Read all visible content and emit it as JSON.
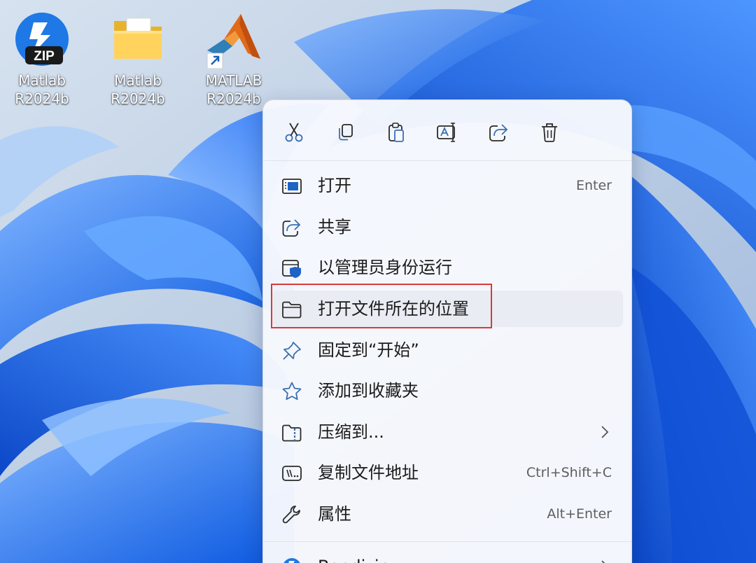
{
  "desktop": {
    "icons": [
      {
        "icon": "zip-archive-icon",
        "line1": "Matlab",
        "line2": "R2024b"
      },
      {
        "icon": "folder-icon",
        "line1": "Matlab",
        "line2": "R2024b"
      },
      {
        "icon": "matlab-shortcut-icon",
        "line1": "MATLAB",
        "line2": "R2024b"
      }
    ]
  },
  "context_menu": {
    "toolbar": [
      {
        "name": "cut",
        "icon": "scissors-icon"
      },
      {
        "name": "copy",
        "icon": "copy-icon"
      },
      {
        "name": "paste",
        "icon": "clipboard-icon"
      },
      {
        "name": "rename",
        "icon": "rename-icon"
      },
      {
        "name": "share",
        "icon": "share-icon"
      },
      {
        "name": "delete",
        "icon": "trash-icon"
      }
    ],
    "items": [
      {
        "label": "打开",
        "shortcut": "Enter",
        "icon": "open-app-icon"
      },
      {
        "label": "共享",
        "shortcut": "",
        "icon": "share-icon"
      },
      {
        "label": "以管理员身份运行",
        "shortcut": "",
        "icon": "admin-shield-icon"
      },
      {
        "label": "打开文件所在的位置",
        "shortcut": "",
        "icon": "folder-open-icon",
        "highlighted": true
      },
      {
        "label": "固定到“开始”",
        "shortcut": "",
        "icon": "pin-icon"
      },
      {
        "label": "添加到收藏夹",
        "shortcut": "",
        "icon": "star-icon"
      },
      {
        "label": "压缩到...",
        "shortcut": "",
        "icon": "zip-folder-icon",
        "submenu": true
      },
      {
        "label": "复制文件地址",
        "shortcut": "Ctrl+Shift+C",
        "icon": "copy-path-icon"
      },
      {
        "label": "属性",
        "shortcut": "Alt+Enter",
        "icon": "wrench-icon"
      },
      {
        "label": "Bandizip",
        "shortcut": "",
        "icon": "bandizip-icon",
        "submenu": true
      }
    ]
  },
  "colors": {
    "highlight_border": "#d93a3a",
    "wallpaper_blue": "#1a6ff0",
    "menu_background": "#f6f8fd"
  }
}
